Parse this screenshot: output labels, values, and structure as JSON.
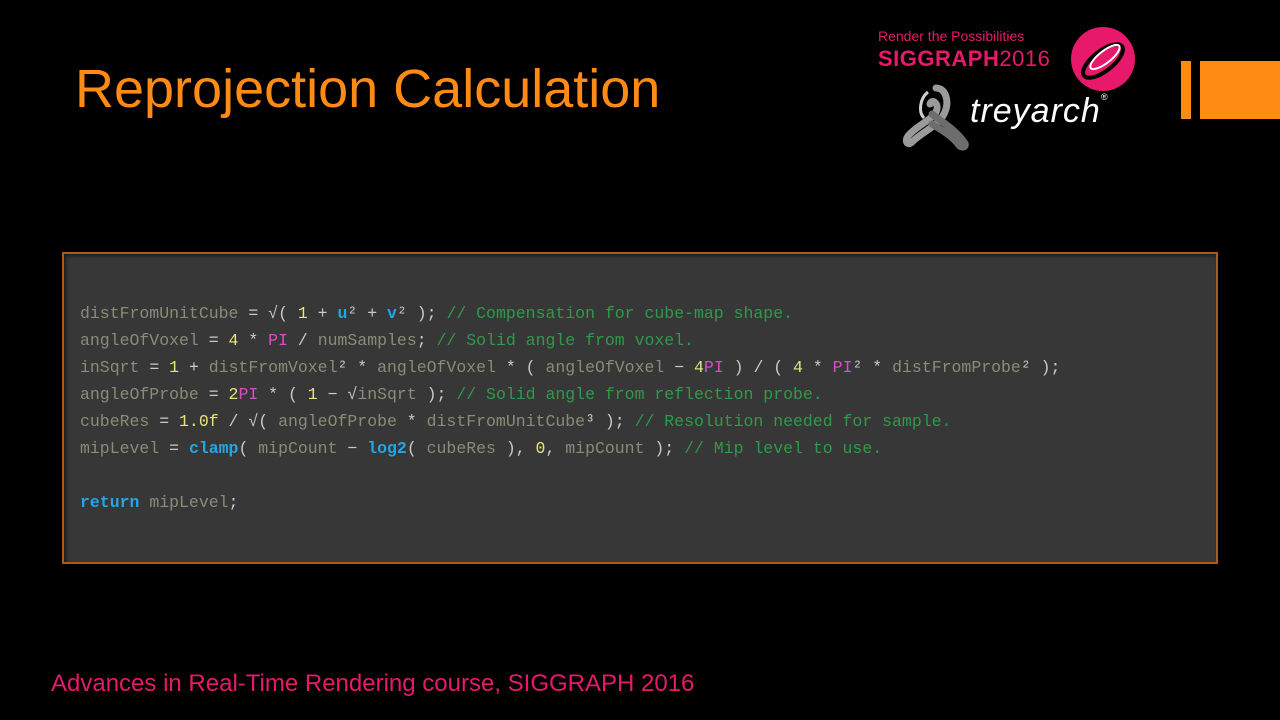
{
  "slide": {
    "title": "Reprojection Calculation",
    "footer": "Advances in Real-Time Rendering course, SIGGRAPH 2016"
  },
  "branding": {
    "tagline": "Render the Possibilities",
    "conference": "SIGGRAPH",
    "year": "2016",
    "studio": "treyarch",
    "trademark": "®",
    "accent_color": "#ff8a14",
    "brand_color": "#e8196a"
  },
  "code": {
    "line1": {
      "var": "distFromUnitCube",
      "eq": " = ",
      "sqrt": "√",
      "open": "( ",
      "one": "1",
      "plus1": " + ",
      "u": "u",
      "sq1": "²",
      "plus2": " + ",
      "v": "v",
      "sq2": "²",
      "close": " ); ",
      "comment": "// Compensation for cube-map shape."
    },
    "line2": {
      "var": "angleOfVoxel",
      "eq": " = ",
      "four": "4",
      "mul": " * ",
      "pi": "PI",
      "div": " / ",
      "samples": "numSamples",
      "semi": "; ",
      "comment": "// Solid angle from voxel."
    },
    "line3": {
      "var": "inSqrt",
      "eq": " = ",
      "one": "1",
      "plus": " + ",
      "dv": "distFromVoxel",
      "sq1": "²",
      "mul1": " * ",
      "aov1": "angleOfVoxel",
      "mul2": " * ( ",
      "aov2": "angleOfVoxel",
      "minus": " − ",
      "four1": "4",
      "pi1": "PI",
      "div": " ) / ( ",
      "four2": "4",
      "mul3": " * ",
      "pi2": "PI",
      "sq2": "²",
      "mul4": " * ",
      "dp": "distFromProbe",
      "sq3": "²",
      "end": " );"
    },
    "line4": {
      "var": "angleOfProbe",
      "eq": " = ",
      "two": "2",
      "pi": "PI",
      "mul": " * ( ",
      "one": "1",
      "minus": " − ",
      "sqrt": "√",
      "arg": "inSqrt",
      "close": " ); ",
      "comment": "// Solid angle from reflection probe."
    },
    "line5": {
      "var": "cubeRes",
      "eq": " = ",
      "num": "1.0f",
      "div": " / ",
      "sqrt": "√",
      "open": "( ",
      "aop": "angleOfProbe",
      "mul": " * ",
      "duc": "distFromUnitCube",
      "cube": "³",
      "close": " ); ",
      "comment": "// Resolution needed for sample."
    },
    "line6": {
      "var": "mipLevel",
      "eq": " = ",
      "clamp": "clamp",
      "open1": "( ",
      "mc1": "mipCount",
      "minus": " − ",
      "log": "log2",
      "open2": "( ",
      "cr": "cubeRes",
      "close1": " ), ",
      "zero": "0",
      "comma": ", ",
      "mc2": "mipCount",
      "close2": " ); ",
      "comment": "// Mip level to use."
    },
    "line8": {
      "ret": "return",
      "space": " ",
      "var": "mipLevel",
      "semi": ";"
    }
  }
}
